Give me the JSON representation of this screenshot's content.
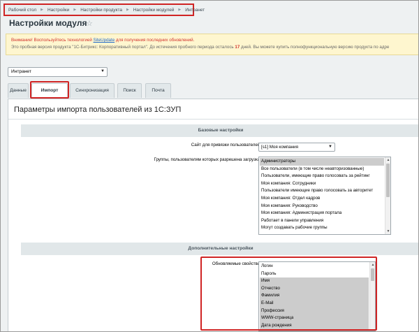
{
  "breadcrumb": [
    "Рабочий стол",
    "Настройки",
    "Настройки продукта",
    "Настройки модулей",
    "Интранет"
  ],
  "page_title": "Настройки модуля",
  "notice": {
    "line1_warning": "Внимание! Воспользуйтесь технологией",
    "line1_link": "SiteUpdate",
    "line1_rest": " для получения последних обновлений.",
    "line2_start": "Это пробная версия продукта \"1С-Битрикс: Корпоративный портал\". До истечения пробного периода осталось ",
    "line2_days": "17",
    "line2_end": " дней. Вы можете купить полнофункциональную версию продукта по адре"
  },
  "site_select": {
    "value": "Интранет"
  },
  "tabs": [
    "Данные",
    "Импорт",
    "Синхронизация",
    "Поиск",
    "Почта"
  ],
  "active_tab": "Импорт",
  "section_title": "Параметры импорта пользователей из 1С:ЗУП",
  "basic_settings": {
    "header": "Базовые настройки",
    "site_label": "Сайт для привязки пользователей:",
    "site_value": "[s1] Моя компания",
    "groups_label": "Группы, пользователям которых разрешена загрузка:",
    "groups": [
      "Администраторы",
      "Все пользователи (в том числе неавторизованные)",
      "Пользователи, имеющие право голосовать за рейтинг",
      "Моя компания: Сотрудники",
      "Пользователи имеющие право голосовать за авторитет",
      "Моя компания: Отдел кадров",
      "Моя компания: Руководство",
      "Моя компания: Администрация портала",
      "Работает в панели управления",
      "Могут создавать рабочие группы"
    ],
    "groups_selected": [
      0
    ]
  },
  "additional_settings": {
    "header": "Дополнительные настройки",
    "props_label": "Обновляемые свойства:",
    "props": [
      "Логин",
      "Пароль",
      "Имя",
      "Отчество",
      "Фамилия",
      "E-Mail",
      "Профессия",
      "WWW-страница",
      "Дата рождения"
    ],
    "props_selected": [
      2,
      3,
      4,
      5,
      6,
      7,
      8
    ]
  },
  "colors": {
    "highlight": "#d02424",
    "selected_option": "#cccccc",
    "header_bg": "#e1e7e9",
    "warning": "#d2322d",
    "link": "#2068c8"
  }
}
